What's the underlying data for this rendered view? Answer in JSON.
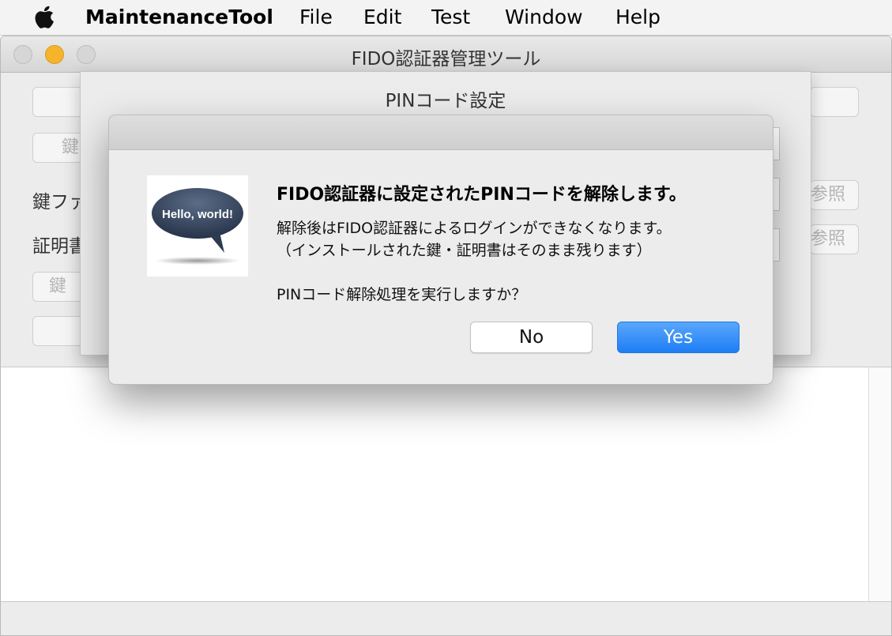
{
  "menubar": {
    "app_name": "MaintenanceTool",
    "items": [
      "File",
      "Edit",
      "Test",
      "Window",
      "Help"
    ]
  },
  "window": {
    "title": "FIDO認証器管理ツール",
    "labels": [
      "鍵ファ",
      "証明書"
    ],
    "buttons": [
      "鍵",
      "参照",
      "参照",
      "鍵"
    ]
  },
  "sheet": {
    "title": "PINコード設定"
  },
  "alert": {
    "icon_text": "Hello, world!",
    "heading": "FIDO認証器に設定されたPINコードを解除します。",
    "line1": "解除後はFIDO認証器によるログインができなくなります。",
    "line2": "（インストールされた鍵・証明書はそのまま残ります）",
    "question": "PINコード解除処理を実行しますか？",
    "no_label": "No",
    "yes_label": "Yes"
  },
  "colors": {
    "accent": "#2a86f7",
    "traffic_close": "#d4d4d4",
    "traffic_minimize": "#f5b42c",
    "traffic_zoom": "#d4d4d4"
  }
}
